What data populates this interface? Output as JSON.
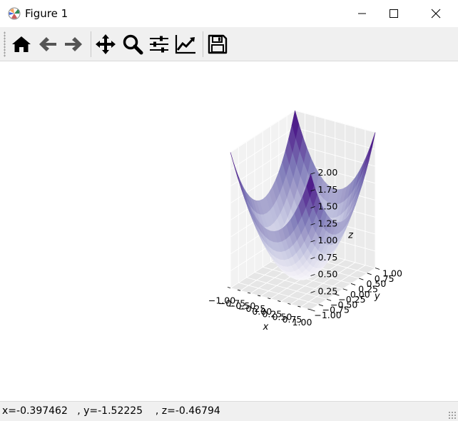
{
  "window": {
    "title": "Figure 1"
  },
  "toolbar": {
    "buttons": [
      "home-icon",
      "back-arrow-icon",
      "forward-arrow-icon",
      "pan-icon",
      "zoom-icon",
      "subplots-icon",
      "customize-icon",
      "save-icon"
    ]
  },
  "status": {
    "coords": "x=-0.397462   , y=-1.52225    , z=-0.46794"
  },
  "colors": {
    "toolbar_bg": "#f0f0f0",
    "surface_high": "#3f007d",
    "surface_low": "#fcfbfd",
    "pane_bg": "#f2f2f2"
  },
  "chart_data": {
    "type": "surface",
    "function": "z = x^2 + y^2",
    "colormap": "Purples",
    "title": "",
    "xlabel": "x",
    "ylabel": "y",
    "zlabel": "z",
    "xlim": [
      -1,
      1
    ],
    "ylim": [
      -1,
      1
    ],
    "zlim": [
      0,
      2
    ],
    "x_ticks": [
      "−1.00",
      "−0.75",
      "−0.50",
      "−0.25",
      "0.00",
      "0.25",
      "0.50",
      "0.75",
      "1.00"
    ],
    "y_ticks": [
      "−1.00",
      "−0.75",
      "−0.50",
      "−0.25",
      "0.00",
      "0.25",
      "0.50",
      "0.75",
      "1.00"
    ],
    "z_ticks": [
      "0.25",
      "0.50",
      "0.75",
      "1.00",
      "1.25",
      "1.50",
      "1.75",
      "2.00"
    ],
    "x": [
      -1,
      -0.9,
      -0.8,
      -0.7,
      -0.6,
      -0.5,
      -0.4,
      -0.3,
      -0.2,
      -0.1,
      0,
      0.1,
      0.2,
      0.3,
      0.4,
      0.5,
      0.6,
      0.7,
      0.8,
      0.9,
      1
    ],
    "y": [
      -1,
      -0.9,
      -0.8,
      -0.7,
      -0.6,
      -0.5,
      -0.4,
      -0.3,
      -0.2,
      -0.1,
      0,
      0.1,
      0.2,
      0.3,
      0.4,
      0.5,
      0.6,
      0.7,
      0.8,
      0.9,
      1
    ],
    "grid": true
  }
}
